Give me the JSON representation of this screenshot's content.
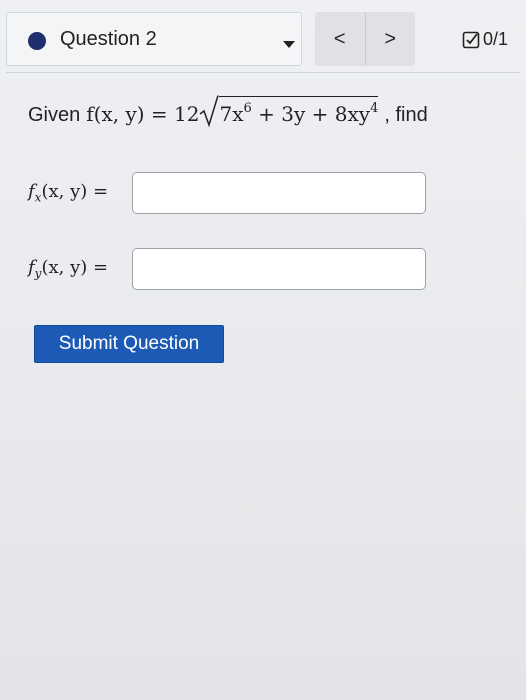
{
  "header": {
    "question_label": "Question 2",
    "prev_label": "<",
    "next_label": ">",
    "score": "0/1"
  },
  "prompt": {
    "lead": "Given",
    "func": "f(x, y) = 12",
    "term1": "7x",
    "term1_exp": "6",
    "term2": " + 3y + 8xy",
    "term2_exp": "4",
    "tail": ", find"
  },
  "answers": [
    {
      "label_fn": "f",
      "label_sub": "x",
      "label_rest": "(x, y) =",
      "value": "",
      "placeholder": ""
    },
    {
      "label_fn": "f",
      "label_sub": "y",
      "label_rest": "(x, y) =",
      "value": "",
      "placeholder": ""
    }
  ],
  "submit_label": "Submit Question",
  "colors": {
    "accent": "#1d5ab6",
    "dot": "#1f2f6e"
  }
}
